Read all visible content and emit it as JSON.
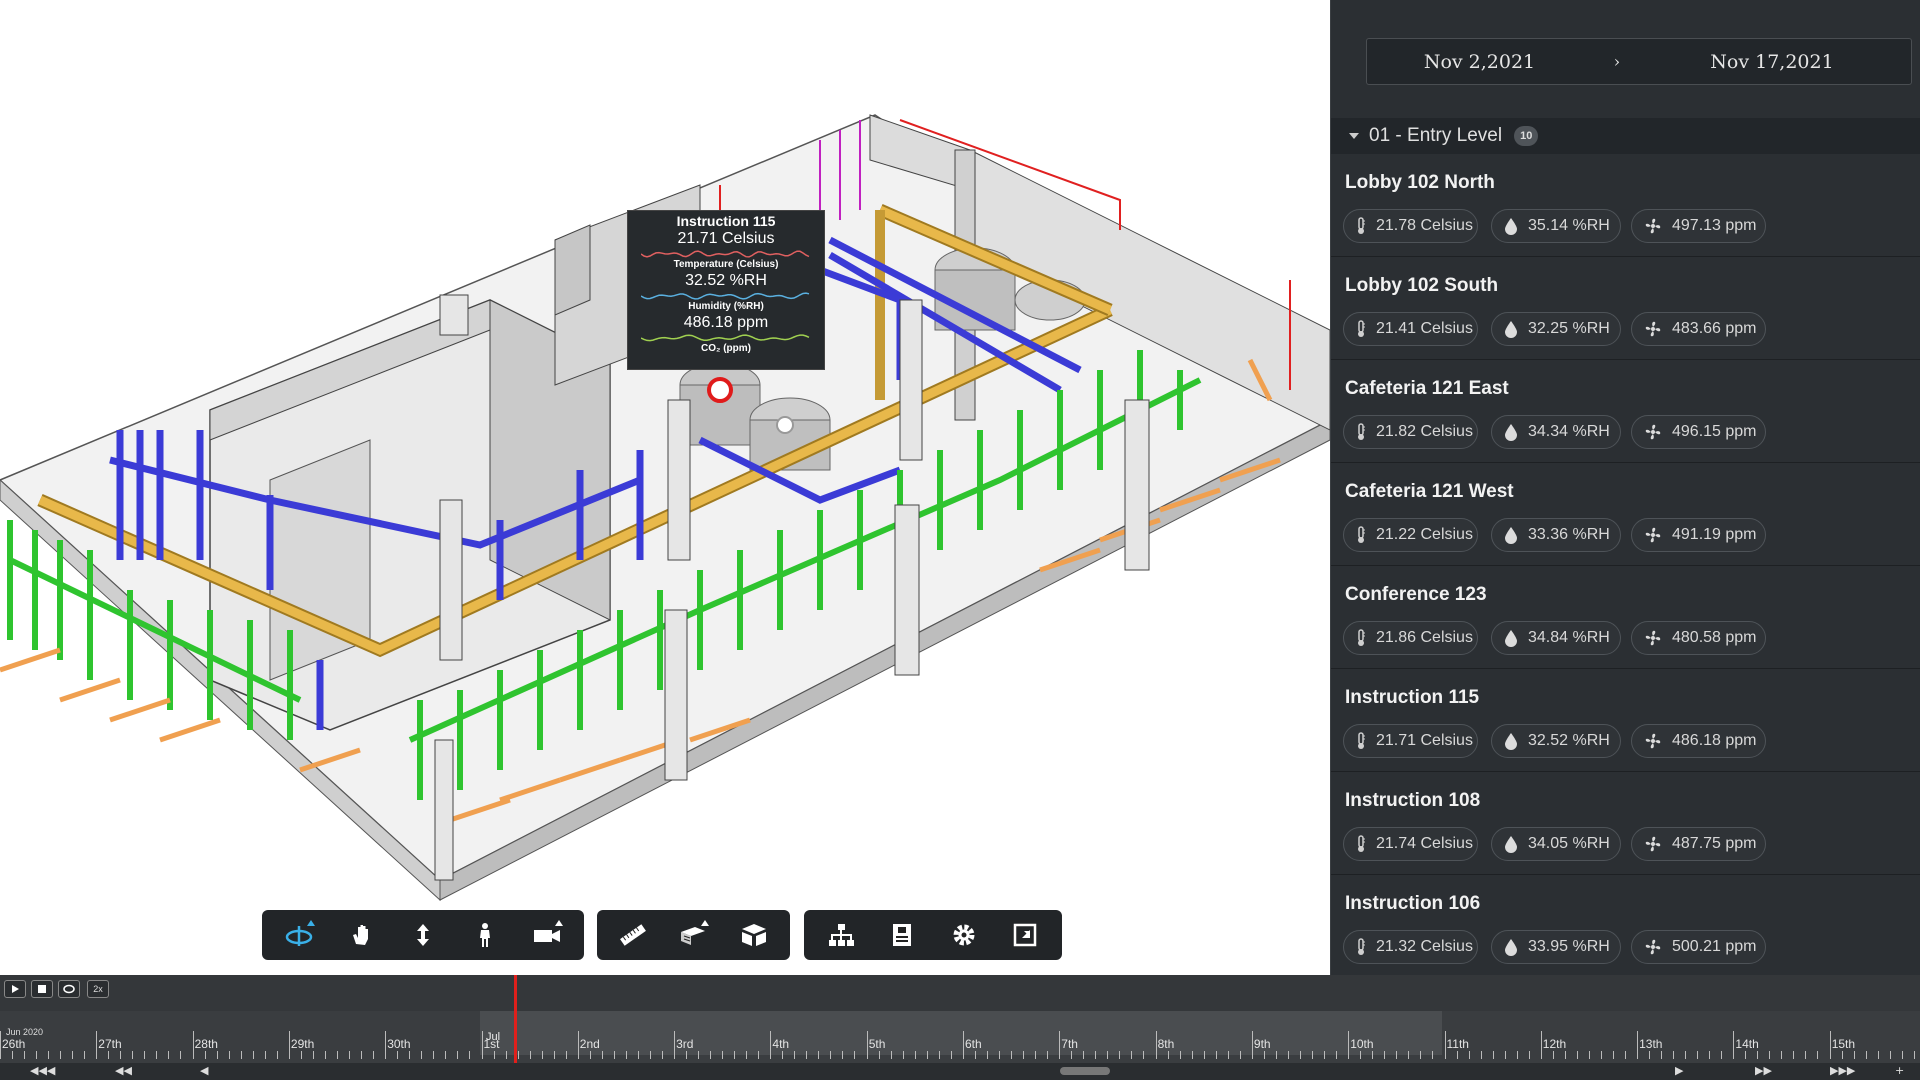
{
  "date_range": {
    "start": "Nov 2,2021",
    "arrow": "›",
    "end": "Nov 17,2021"
  },
  "level": {
    "name": "01 - Entry Level",
    "count": "10"
  },
  "rooms": [
    {
      "name": "Lobby 102 North",
      "temp": "21.78 Celsius",
      "humidity": "35.14 %RH",
      "co2": "497.13 ppm"
    },
    {
      "name": "Lobby 102 South",
      "temp": "21.41 Celsius",
      "humidity": "32.25 %RH",
      "co2": "483.66 ppm"
    },
    {
      "name": "Cafeteria 121 East",
      "temp": "21.82 Celsius",
      "humidity": "34.34 %RH",
      "co2": "496.15 ppm"
    },
    {
      "name": "Cafeteria 121 West",
      "temp": "21.22 Celsius",
      "humidity": "33.36 %RH",
      "co2": "491.19 ppm"
    },
    {
      "name": "Conference 123",
      "temp": "21.86 Celsius",
      "humidity": "34.84 %RH",
      "co2": "480.58 ppm"
    },
    {
      "name": "Instruction 115",
      "temp": "21.71 Celsius",
      "humidity": "32.52 %RH",
      "co2": "486.18 ppm"
    },
    {
      "name": "Instruction 108",
      "temp": "21.74 Celsius",
      "humidity": "34.05 %RH",
      "co2": "487.75 ppm"
    },
    {
      "name": "Instruction 106",
      "temp": "21.32 Celsius",
      "humidity": "33.95 %RH",
      "co2": "500.21 ppm"
    }
  ],
  "tooltip": {
    "title": "Instruction 115",
    "temp_value": "21.71 Celsius",
    "temp_label": "Temperature (Celsius)",
    "humidity_value": "32.52 %RH",
    "humidity_label": "Humidity (%RH)",
    "co2_value": "486.18 ppm",
    "co2_label": "CO₂ (ppm)"
  },
  "toolbar": {
    "groups": [
      [
        "orbit-icon",
        "pan-icon",
        "dolly-icon",
        "first-person-icon",
        "camera-icon"
      ],
      [
        "measure-icon",
        "section-icon",
        "explode-model-icon"
      ],
      [
        "model-browser-icon",
        "properties-icon",
        "settings-icon",
        "fullscreen-icon"
      ]
    ],
    "active": "orbit-icon"
  },
  "timeline": {
    "speed_label": "2x",
    "month_start": "Jun 2020",
    "month_jul": "Jul",
    "days": [
      "26th",
      "27th",
      "28th",
      "29th",
      "30th",
      "1st",
      "2nd",
      "3rd",
      "4th",
      "5th",
      "6th",
      "7th",
      "8th",
      "9th",
      "10th",
      "11th",
      "12th",
      "13th",
      "14th",
      "15th"
    ]
  },
  "colors": {
    "panel_bg": "#2b2f33",
    "accent": "#3ab0e8",
    "marker": "#e0201c",
    "pipe_blue": "#3b3bd6",
    "pipe_green": "#2fc42f",
    "pipe_orange": "#f0a050",
    "pipe_gold": "#e8b84a"
  }
}
